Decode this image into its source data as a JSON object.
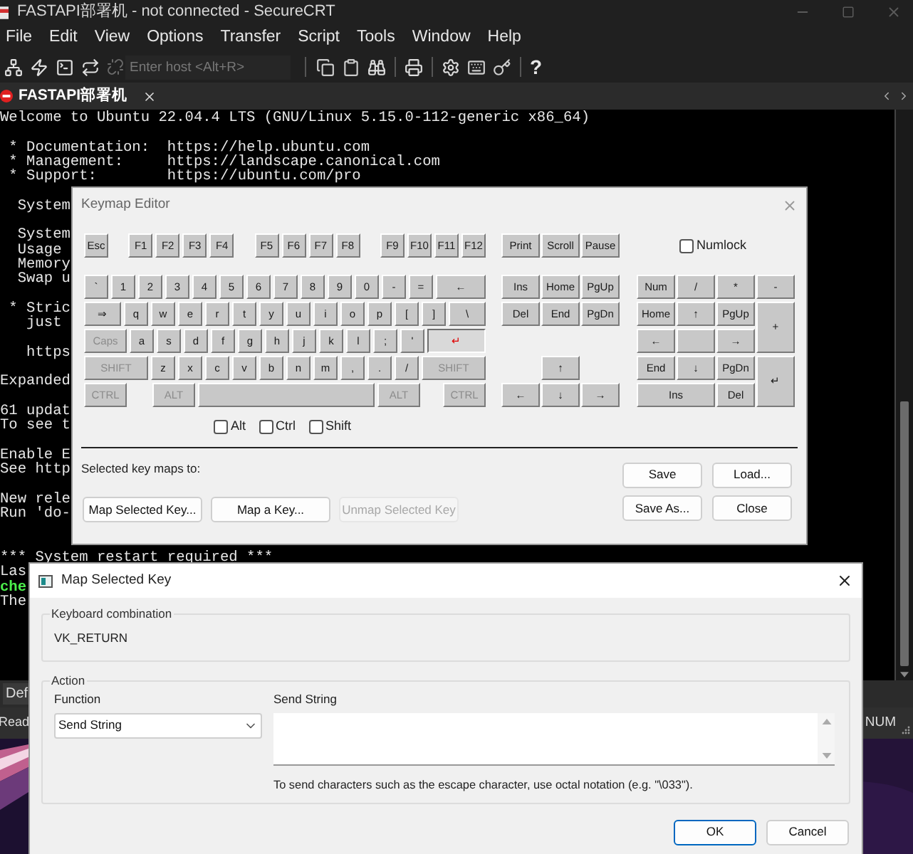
{
  "window": {
    "title": "FASTAPI部署机 - not connected - SecureCRT"
  },
  "menu": [
    "File",
    "Edit",
    "View",
    "Options",
    "Transfer",
    "Script",
    "Tools",
    "Window",
    "Help"
  ],
  "toolbar": {
    "host_field": {
      "placeholder": "Enter host <Alt+R>"
    },
    "help": "?"
  },
  "tabs": [
    {
      "label": "FASTAPI部署机",
      "selected": true
    }
  ],
  "terminal": {
    "lines": [
      {
        "kind": "text",
        "text": "Welcome to Ubuntu 22.04.4 LTS (GNU/Linux 5.15.0-112-generic x86_64)",
        "color": "#e6e6e6"
      },
      {
        "kind": "blank"
      },
      {
        "kind": "text",
        "text": " * Documentation:  https://help.ubuntu.com",
        "color": "#e6e6e6"
      },
      {
        "kind": "text",
        "text": " * Management:     https://landscape.canonical.com",
        "color": "#e6e6e6"
      },
      {
        "kind": "text",
        "text": " * Support:        https://ubuntu.com/pro",
        "color": "#e6e6e6"
      },
      {
        "kind": "blank"
      },
      {
        "kind": "text",
        "text": "  System",
        "color": "#e6e6e6"
      },
      {
        "kind": "blank"
      },
      {
        "kind": "text",
        "text": "  System",
        "color": "#e6e6e6"
      },
      {
        "kind": "text",
        "text": "  Usage",
        "color": "#e6e6e6"
      },
      {
        "kind": "text",
        "text": "  Memory",
        "color": "#e6e6e6"
      },
      {
        "kind": "text",
        "text": "  Swap u",
        "color": "#e6e6e6"
      },
      {
        "kind": "blank"
      },
      {
        "kind": "text",
        "text": " * Stric",
        "color": "#e6e6e6"
      },
      {
        "kind": "text",
        "text": "   just",
        "color": "#e6e6e6"
      },
      {
        "kind": "blank"
      },
      {
        "kind": "text",
        "text": "   https",
        "color": "#e6e6e6"
      },
      {
        "kind": "blank"
      },
      {
        "kind": "text",
        "text": "Expanded",
        "color": "#e6e6e6"
      },
      {
        "kind": "blank"
      },
      {
        "kind": "text",
        "text": "61 updat",
        "color": "#e6e6e6"
      },
      {
        "kind": "text",
        "text": "To see t",
        "color": "#e6e6e6"
      },
      {
        "kind": "blank"
      },
      {
        "kind": "text",
        "text": "Enable E",
        "color": "#e6e6e6"
      },
      {
        "kind": "text",
        "text": "See http",
        "color": "#e6e6e6"
      },
      {
        "kind": "blank"
      },
      {
        "kind": "text",
        "text": "New rele",
        "color": "#e6e6e6"
      },
      {
        "kind": "text",
        "text": "Run 'do-",
        "color": "#e6e6e6"
      },
      {
        "kind": "blank"
      },
      {
        "kind": "blank"
      },
      {
        "kind": "text",
        "text": "*** System restart required ***",
        "color": "#e6e6e6"
      },
      {
        "kind": "text",
        "text": "Las",
        "color": "#e6e6e6"
      },
      {
        "kind": "text",
        "text": "che",
        "color": "#4cf04c"
      },
      {
        "kind": "text",
        "text": "The",
        "color": "#e6e6e6"
      }
    ]
  },
  "button_bar": {
    "buttons": [
      "Def"
    ]
  },
  "status_bar": {
    "left": "Read",
    "right": "NUM"
  },
  "keymap_editor": {
    "title": "Keymap Editor",
    "function_groups": [
      {
        "keys": [
          {
            "label": "Esc",
            "selected": false
          }
        ]
      },
      {
        "keys": [
          {
            "label": "F1",
            "selected": false
          },
          {
            "label": "F2",
            "selected": false
          },
          {
            "label": "F3",
            "selected": false
          },
          {
            "label": "F4",
            "selected": false
          }
        ]
      },
      {
        "keys": [
          {
            "label": "F5",
            "selected": false
          },
          {
            "label": "F6",
            "selected": false
          },
          {
            "label": "F7",
            "selected": false
          },
          {
            "label": "F8",
            "selected": false
          }
        ]
      },
      {
        "keys": [
          {
            "label": "F9",
            "selected": false
          },
          {
            "label": "F10",
            "selected": false
          },
          {
            "label": "F11",
            "selected": false
          },
          {
            "label": "F12",
            "selected": false
          }
        ]
      }
    ],
    "system_keys": [
      {
        "label": "Print",
        "selected": false
      },
      {
        "label": "Scroll",
        "selected": false
      },
      {
        "label": "Pause",
        "selected": false
      }
    ],
    "numlock": {
      "label": "Numlock",
      "checked": false
    },
    "main_rows": [
      {
        "keys": [
          {
            "label": "`",
            "kind": "key",
            "selected": false
          },
          {
            "label": "1",
            "kind": "key",
            "selected": false
          },
          {
            "label": "2",
            "kind": "key",
            "selected": false
          },
          {
            "label": "3",
            "kind": "key",
            "selected": false
          },
          {
            "label": "4",
            "kind": "key",
            "selected": false
          },
          {
            "label": "5",
            "kind": "key",
            "selected": false
          },
          {
            "label": "6",
            "kind": "key",
            "selected": false
          },
          {
            "label": "7",
            "kind": "key",
            "selected": false
          },
          {
            "label": "8",
            "kind": "key",
            "selected": false
          },
          {
            "label": "9",
            "kind": "key",
            "selected": false
          },
          {
            "label": "0",
            "kind": "key",
            "selected": false
          },
          {
            "label": "-",
            "kind": "key",
            "selected": false
          },
          {
            "label": "=",
            "kind": "key",
            "selected": false
          },
          {
            "label": "←",
            "kind": "wide",
            "selected": false
          }
        ]
      },
      {
        "keys": [
          {
            "label": "⇒",
            "kind": "wide",
            "selected": false
          },
          {
            "label": "q",
            "kind": "key",
            "selected": false
          },
          {
            "label": "w",
            "kind": "key",
            "selected": false
          },
          {
            "label": "e",
            "kind": "key",
            "selected": false
          },
          {
            "label": "r",
            "kind": "key",
            "selected": false
          },
          {
            "label": "t",
            "kind": "key",
            "selected": false
          },
          {
            "label": "y",
            "kind": "key",
            "selected": false
          },
          {
            "label": "u",
            "kind": "key",
            "selected": false
          },
          {
            "label": "i",
            "kind": "key",
            "selected": false
          },
          {
            "label": "o",
            "kind": "key",
            "selected": false
          },
          {
            "label": "p",
            "kind": "key",
            "selected": false
          },
          {
            "label": "[",
            "kind": "key",
            "selected": false
          },
          {
            "label": "]",
            "kind": "key",
            "selected": false
          },
          {
            "label": "\\",
            "kind": "wide",
            "selected": false
          }
        ]
      },
      {
        "keys": [
          {
            "label": "Caps",
            "kind": "modifier",
            "selected": false
          },
          {
            "label": "a",
            "kind": "key",
            "selected": false
          },
          {
            "label": "s",
            "kind": "key",
            "selected": false
          },
          {
            "label": "d",
            "kind": "key",
            "selected": false
          },
          {
            "label": "f",
            "kind": "key",
            "selected": false
          },
          {
            "label": "g",
            "kind": "key",
            "selected": false
          },
          {
            "label": "h",
            "kind": "key",
            "selected": false
          },
          {
            "label": "j",
            "kind": "key",
            "selected": false
          },
          {
            "label": "k",
            "kind": "key",
            "selected": false
          },
          {
            "label": "l",
            "kind": "key",
            "selected": false
          },
          {
            "label": ";",
            "kind": "key",
            "selected": false
          },
          {
            "label": "'",
            "kind": "key",
            "selected": false
          },
          {
            "label": "↵",
            "kind": "wide",
            "selected": true
          }
        ]
      },
      {
        "keys": [
          {
            "label": "SHIFT",
            "kind": "modifier-wide",
            "selected": false
          },
          {
            "label": "z",
            "kind": "key",
            "selected": false
          },
          {
            "label": "x",
            "kind": "key",
            "selected": false
          },
          {
            "label": "c",
            "kind": "key",
            "selected": false
          },
          {
            "label": "v",
            "kind": "key",
            "selected": false
          },
          {
            "label": "b",
            "kind": "key",
            "selected": false
          },
          {
            "label": "n",
            "kind": "key",
            "selected": false
          },
          {
            "label": "m",
            "kind": "key",
            "selected": false
          },
          {
            "label": ",",
            "kind": "key",
            "selected": false
          },
          {
            "label": ".",
            "kind": "key",
            "selected": false
          },
          {
            "label": "/",
            "kind": "key",
            "selected": false
          },
          {
            "label": "SHIFT",
            "kind": "modifier-wide",
            "selected": false
          }
        ]
      },
      {
        "keys": [
          {
            "label": "CTRL",
            "kind": "modifier",
            "selected": false
          },
          {
            "label": "ALT",
            "kind": "alt",
            "selected": false
          },
          {
            "kind": "space",
            "selected": false
          },
          {
            "label": "ALT",
            "kind": "alt",
            "selected": false
          },
          {
            "label": "CTRL",
            "kind": "modifier",
            "selected": false
          }
        ]
      }
    ],
    "nav_rows": [
      {
        "keys": [
          {
            "label": "Ins",
            "selected": false
          },
          {
            "label": "Home",
            "selected": false
          },
          {
            "label": "PgUp",
            "selected": false
          }
        ]
      },
      {
        "keys": [
          {
            "label": "Del",
            "selected": false
          },
          {
            "label": "End",
            "selected": false
          },
          {
            "label": "PgDn",
            "selected": false
          }
        ]
      }
    ],
    "arrow_rows": [
      {
        "keys": [
          {
            "label": "↑",
            "selected": false
          }
        ]
      },
      {
        "keys": [
          {
            "label": "←",
            "selected": false
          },
          {
            "label": "↓",
            "selected": false
          },
          {
            "label": "→",
            "selected": false
          }
        ]
      }
    ],
    "numpad": [
      {
        "label": "Num",
        "kind": "key",
        "selected": false
      },
      {
        "label": "/",
        "kind": "key",
        "selected": false
      },
      {
        "label": "*",
        "kind": "key",
        "selected": false
      },
      {
        "label": "-",
        "kind": "key",
        "selected": false
      },
      {
        "label": "Home",
        "kind": "key",
        "selected": false
      },
      {
        "label": "↑",
        "kind": "key",
        "selected": false
      },
      {
        "label": "PgUp",
        "kind": "key",
        "selected": false
      },
      {
        "label": "+",
        "kind": "tall",
        "selected": false
      },
      {
        "label": "←",
        "kind": "key",
        "selected": false
      },
      {
        "kind": "blank",
        "selected": false
      },
      {
        "label": "→",
        "kind": "key",
        "selected": false
      },
      {
        "label": "End",
        "kind": "key",
        "selected": false
      },
      {
        "label": "↓",
        "kind": "key",
        "selected": false
      },
      {
        "label": "PgDn",
        "kind": "key",
        "selected": false
      },
      {
        "label": "↵",
        "kind": "tall",
        "selected": false
      },
      {
        "label": "Ins",
        "kind": "double",
        "selected": false
      },
      {
        "label": "Del",
        "kind": "key",
        "selected": false
      }
    ],
    "modifiers": [
      {
        "label": "Alt",
        "checked": false
      },
      {
        "label": "Ctrl",
        "checked": false
      },
      {
        "label": "Shift",
        "checked": false
      }
    ],
    "maps_to_label": "Selected key maps to:",
    "map_buttons": [
      {
        "label": "Map Selected Key...",
        "disabled": false
      },
      {
        "label": "Map a Key...",
        "disabled": false
      },
      {
        "label": "Unmap Selected Key",
        "disabled": true
      }
    ],
    "file_buttons": [
      "Save",
      "Load...",
      "Save As...",
      "Close"
    ]
  },
  "map_selected_key": {
    "title": "Map Selected Key",
    "keyboard_combination": {
      "label": "Keyboard combination",
      "value": "VK_RETURN"
    },
    "action": {
      "label": "Action",
      "function_label": "Function",
      "function_value": "Send String",
      "send_string_label": "Send String",
      "hint": "To send characters such as the escape character, use octal notation (e.g. \"\\033\")."
    },
    "buttons": [
      {
        "label": "OK",
        "default": true
      },
      {
        "label": "Cancel",
        "default": false
      }
    ]
  }
}
